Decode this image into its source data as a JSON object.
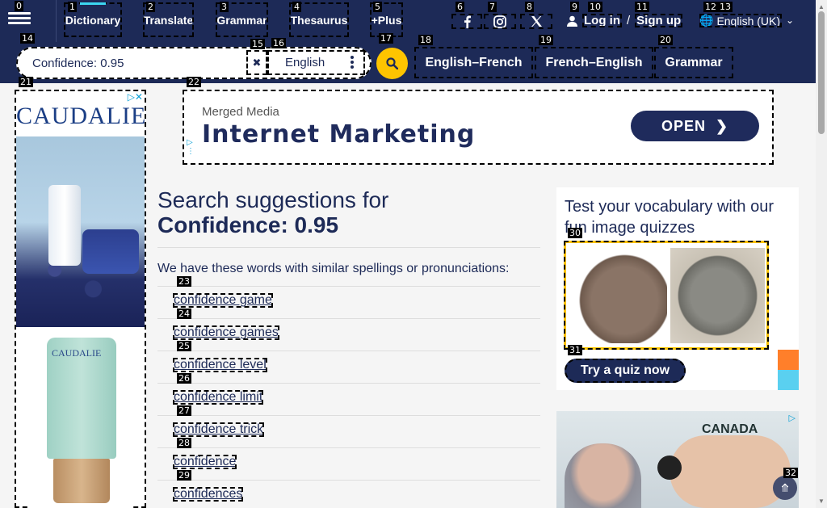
{
  "header": {
    "nav": [
      "Dictionary",
      "Translate",
      "Grammar",
      "Thesaurus",
      "+Plus"
    ],
    "login_label": "Log in",
    "login_sep": "/",
    "signup_label": "Sign up",
    "language": "English (UK)"
  },
  "search": {
    "value": "Confidence: 0.95",
    "dictionary": "English",
    "links": [
      "English–French",
      "French–English",
      "Grammar"
    ]
  },
  "ads": {
    "left_brand": "CAUDALIE",
    "left_product": "CAUDALIE",
    "banner_small": "Merged Media",
    "banner_big": "Internet Marketing",
    "banner_cta": "OPEN",
    "side_country": "CANADA"
  },
  "main": {
    "heading_prefix": "Search suggestions for",
    "heading_term": "Confidence: 0.95",
    "intro": "We have these words with similar spellings or pronunciations:",
    "suggestions": [
      "confidence game",
      "confidence games",
      "confidence level",
      "confidence limit",
      "confidence trick",
      "confidence",
      "confidences"
    ]
  },
  "quiz": {
    "title": "Test your vocabulary with our fun image quizzes",
    "button": "Try a quiz now"
  },
  "tags": [
    "0",
    "1",
    "2",
    "3",
    "4",
    "5",
    "6",
    "7",
    "8",
    "9",
    "10",
    "11",
    "12",
    "13",
    "14",
    "15",
    "16",
    "17",
    "18",
    "19",
    "20",
    "21",
    "22",
    "23",
    "24",
    "25",
    "26",
    "27",
    "28",
    "29",
    "30",
    "31",
    "32"
  ],
  "colors": {
    "navy": "#1d2a57",
    "accent": "#fec400",
    "active_underline": "#3cd6f0"
  }
}
